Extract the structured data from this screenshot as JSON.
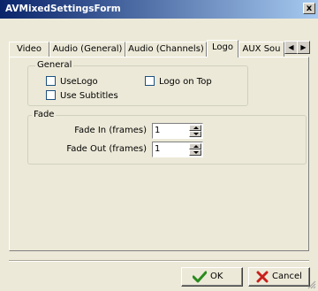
{
  "window": {
    "title": "AVMixedSettingsForm",
    "close_glyph": "x"
  },
  "tabs": [
    {
      "label": "Video",
      "active": false
    },
    {
      "label": "Audio (General)",
      "active": false
    },
    {
      "label": "Audio (Channels)",
      "active": false
    },
    {
      "label": "Logo",
      "active": true
    },
    {
      "label": "AUX Sou",
      "active": false
    }
  ],
  "tab_scroll": {
    "left_glyph": "◀",
    "right_glyph": "▶"
  },
  "general": {
    "title": "General",
    "use_logo": {
      "label": "UseLogo",
      "checked": false
    },
    "logo_on_top": {
      "label": "Logo on Top",
      "checked": false
    },
    "use_subtitles": {
      "label": "Use Subtitles",
      "checked": false
    }
  },
  "fade": {
    "title": "Fade",
    "fade_in": {
      "label": "Fade In (frames)",
      "value": "1"
    },
    "fade_out": {
      "label": "Fade Out (frames)",
      "value": "1"
    }
  },
  "buttons": {
    "ok": {
      "label": "OK",
      "icon": "checkmark-icon",
      "color": "#2a8a1e"
    },
    "cancel": {
      "label": "Cancel",
      "icon": "x-icon",
      "color": "#c8201a"
    }
  }
}
